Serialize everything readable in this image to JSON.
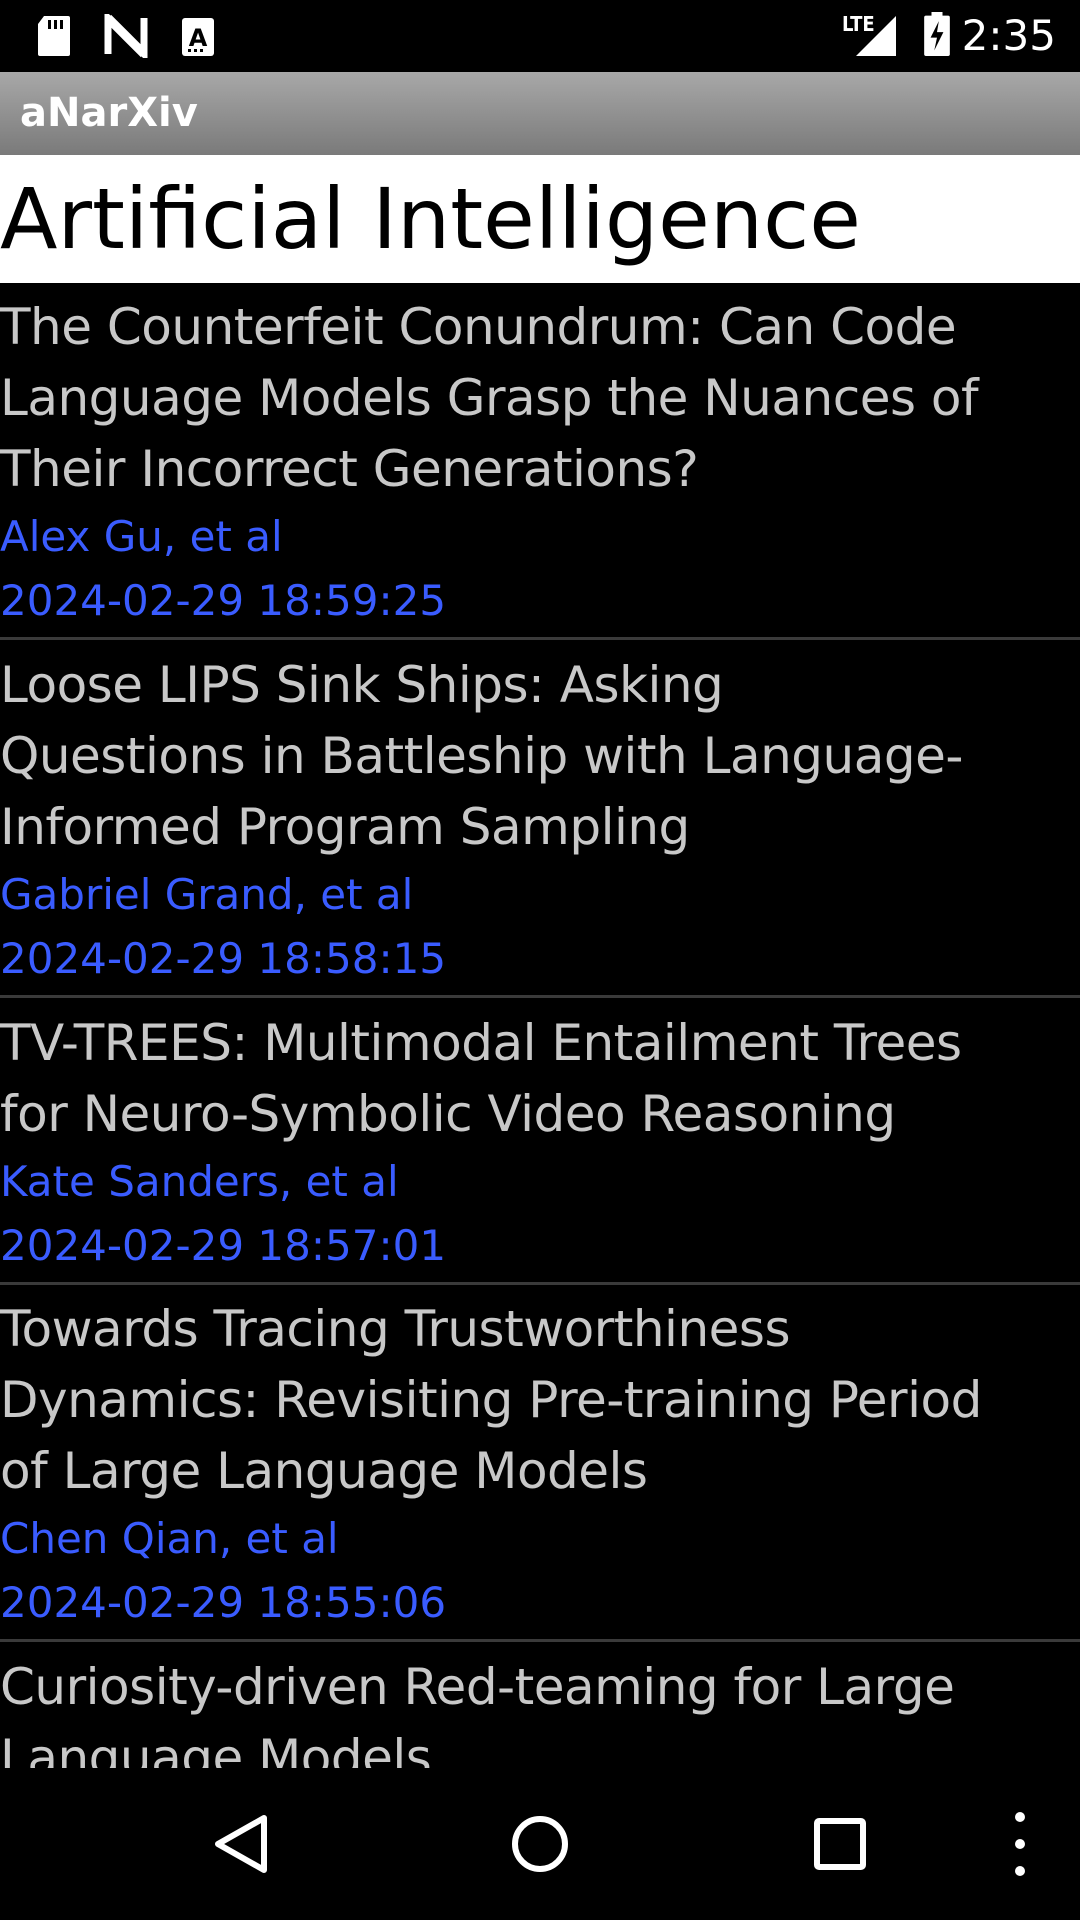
{
  "status_bar": {
    "time": "2:35",
    "network_label": "LTE",
    "icons": [
      "sd-card-icon",
      "n-notification-icon",
      "a-notification-icon",
      "signal-icon",
      "battery-charging-icon"
    ]
  },
  "app_bar": {
    "title": "aNarXiv"
  },
  "category": {
    "title": "Artificial Intelligence"
  },
  "papers": [
    {
      "title": "The Counterfeit Conundrum: Can Code\nLanguage Models Grasp the Nuances of\nTheir Incorrect Generations?",
      "authors": "Alex Gu, et al",
      "date": "2024-02-29 18:59:25"
    },
    {
      "title": "Loose LIPS Sink Ships: Asking\nQuestions in Battleship with  Language-\nInformed Program Sampling",
      "authors": "Gabriel Grand, et al",
      "date": "2024-02-29 18:58:15"
    },
    {
      "title": "TV-TREES: Multimodal Entailment Trees\nfor Neuro-Symbolic Video Reasoning",
      "authors": "Kate Sanders, et al",
      "date": "2024-02-29 18:57:01"
    },
    {
      "title": "Towards Tracing Trustworthiness\nDynamics: Revisiting Pre-training Period\nof Large Language Models",
      "authors": "Chen Qian, et al",
      "date": "2024-02-29 18:55:06"
    },
    {
      "title": "Curiosity-driven Red-teaming for Large\nLanguage Models",
      "authors": "",
      "date": ""
    }
  ],
  "nav_bar": {
    "icons": [
      "back-icon",
      "home-icon",
      "recents-icon",
      "overflow-menu-icon"
    ]
  },
  "colors": {
    "accent_link": "#3a5cff",
    "title_text": "#c8c8c8",
    "background": "#000000"
  }
}
